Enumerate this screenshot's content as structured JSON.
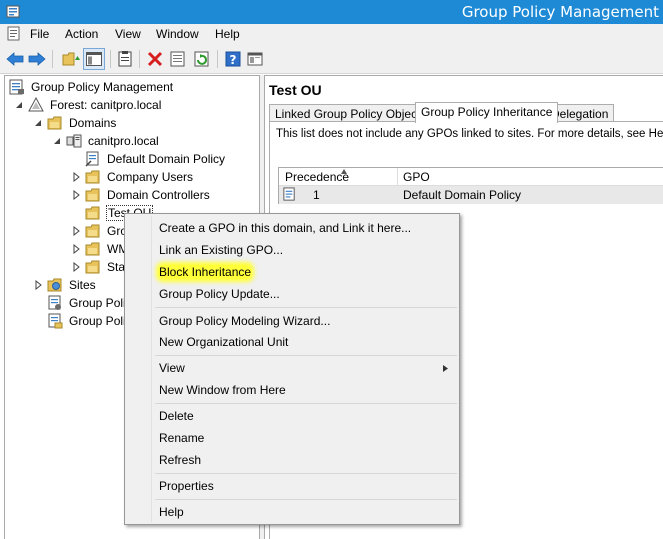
{
  "window": {
    "title": "Group Policy Management"
  },
  "menubar": {
    "items": [
      "File",
      "Action",
      "View",
      "Window",
      "Help"
    ]
  },
  "toolbar": {
    "buttons": [
      "back-icon",
      "forward-icon",
      "up-folder-icon",
      "show-hide-tree-icon",
      "properties-icon",
      "delete-icon",
      "export-icon",
      "refresh-icon",
      "help-icon",
      "console-icon"
    ]
  },
  "tree": {
    "root": "Group Policy Management",
    "forest": "Forest: canitpro.local",
    "domains": "Domains",
    "domain": "canitpro.local",
    "default_policy": "Default Domain Policy",
    "company_users": "Company Users",
    "domain_controllers": "Domain Controllers",
    "test_ou": "Test OU",
    "gro": "Gro",
    "wm": "WM",
    "star": "Star",
    "sites": "Sites",
    "gp_modeling": "Group Polic",
    "gp_results": "Group Polic"
  },
  "detail": {
    "title": "Test OU",
    "tabs": [
      "Linked Group Policy Objects",
      "Group Policy Inheritance",
      "Delegation"
    ],
    "active_tab": "Group Policy Inheritance",
    "note": "This list does not include any GPOs linked to sites. For more details, see Help.",
    "columns": [
      "Precedence",
      "GPO"
    ],
    "rows": [
      {
        "precedence": "1",
        "gpo": "Default Domain Policy"
      }
    ]
  },
  "context_menu": {
    "create_gpo": "Create a GPO in this domain, and Link it here...",
    "link_existing": "Link an Existing GPO...",
    "block_inheritance": "Block Inheritance",
    "gp_update": "Group Policy Update...",
    "modeling_wizard": "Group Policy Modeling Wizard...",
    "new_ou": "New Organizational Unit",
    "view": "View",
    "new_window": "New Window from Here",
    "delete": "Delete",
    "rename": "Rename",
    "refresh": "Refresh",
    "properties": "Properties",
    "help": "Help"
  },
  "colors": {
    "titlebar": "#1e8ad6",
    "highlight": "#ffff3a",
    "folder": "#e8c25a"
  }
}
